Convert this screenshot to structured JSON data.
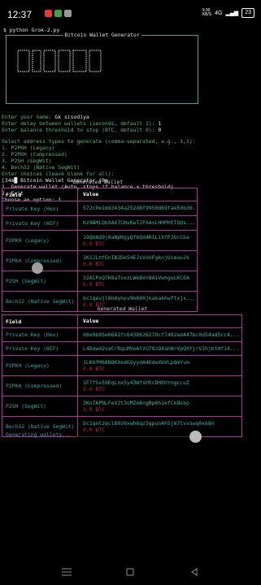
{
  "status_bar": {
    "time": "12:37",
    "speed": "9.00\nKB/S",
    "net": "4G",
    "battery": "23"
  },
  "terminal": {
    "command": "$ python Grok-2.py",
    "panel_title": "Bitcoin Wallet Generator",
    "prompts": [
      {
        "q": "Enter your name: ",
        "a": "Gk sisodiya"
      },
      {
        "q": "Enter delay between wallets (seconds, default 2): ",
        "a": "1"
      },
      {
        "q": "Enter balance threshold to stop (BTC, default 0): ",
        "a": "0"
      }
    ],
    "select_prompt": "Select address types to generate (comma-separated, e.g., 1,3):",
    "types": [
      "1. P2PKH (Legacy)",
      "2. P2PKH (Compressed)",
      "3. P2SH (SegWit)",
      "4. Bech32 (Native SegWit)"
    ],
    "choices_line": "Enter choices (leave blank for all):",
    "menu_title": "[34m█ Bitcoin Wallet Generator [0m",
    "menu_items": [
      "1. Generate wallet (Auto, stops if balance > threshold)",
      "2. Exit"
    ],
    "choose": "Choose an option: 1"
  },
  "wallets": [
    {
      "title": "Generated Wallet",
      "header": {
        "field": "Field",
        "value": "Value"
      },
      "rows": [
        {
          "field": "Private Key (Hex)",
          "value": "572c0e1dd3434a252d8f9950d69fae50b30...",
          "balance": ""
        },
        {
          "field": "Private Key (WIF)",
          "value": "Kz9AMLQbXAX7CNvKwTJF6AsLHHPHtTQQs...",
          "balance": ""
        },
        {
          "field": "P2PKH (Legacy)",
          "value": "19QhAQ9j8aNpKgyQf6Qd4R1LiXfPJGrCba",
          "balance": "0.0 BTC"
        },
        {
          "field": "P2PKH (Compressed)",
          "value": "1K1JLhfGnIB2De54EJsVxUFgknjUceuv2k",
          "balance": "0.0 BTC"
        },
        {
          "field": "P2SH (SegWit)",
          "value": "32AiPxQ7K8aToxzLWkBVn8A1VwhguLKCEA",
          "balance": "0.0 BTC"
        },
        {
          "field": "Bech32 (Native SegWit)",
          "value": "bc1qeujl8h8yhpv9n600jkakakhwftxjx...",
          "balance": "0.0 BTC"
        }
      ]
    },
    {
      "title": "Generated Wallet",
      "header": {
        "field": "Field",
        "value": "Value"
      },
      "rows": [
        {
          "field": "Private Key (Hex)",
          "value": "d0e9b05e6682fc6438626278cf7402aa447bc0d54ad5cc4...",
          "balance": ""
        },
        {
          "field": "Private Key (WIF)",
          "value": "L4Dowd2vaCrRqLMVoAYzU78zDXahNrVpQXYjrV2hjbtHf14...",
          "balance": ""
        },
        {
          "field": "P2PKH (Legacy)",
          "value": "1LKUfM68NQKXedGSyydA4DdeXbVLpQmYvm",
          "balance": "0.0 BTC"
        },
        {
          "field": "P2PKH (Compressed)",
          "value": "1F7fSx59EqLnx5y43WfsHtcDHShYngccuZ",
          "balance": "0.0 BTC"
        },
        {
          "field": "P2SH (SegWit)",
          "value": "3Kn7APNLFeV2t3oMZn6ngBp6h1efCkNxbp",
          "balance": "0.0 BTC"
        },
        {
          "field": "Bech32 (Native SegWit)",
          "value": "bc1qnt2qcl8020xwh6qz5qpun4h5jm7tvvswq0xk8n",
          "balance": "0.0 BTC"
        }
      ]
    }
  ],
  "progress": {
    "label": "Generating wallets...",
    "fraction": 0.03
  },
  "colors": {
    "accent": "#3aa6a0",
    "border": "#b0309a",
    "balance": "#c0243c"
  }
}
